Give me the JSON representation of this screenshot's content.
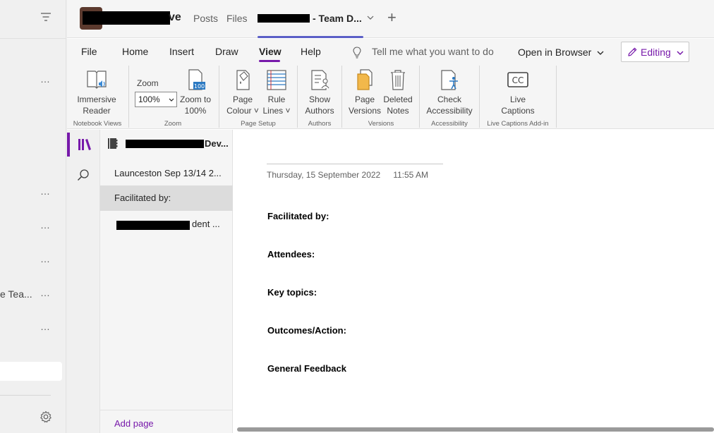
{
  "teams_sidebar": {
    "team_label_fragment": "e Tea...",
    "more_glyph": "…"
  },
  "header": {
    "team_name_suffix": "ve",
    "tabs": [
      "Posts",
      "Files"
    ],
    "active_tab_suffix": "- Team D...",
    "add_tab_glyph": "+"
  },
  "ribbon": {
    "tabs": [
      "File",
      "Home",
      "Insert",
      "Draw",
      "View",
      "Help"
    ],
    "active_tab": "View",
    "tell_me_placeholder": "Tell me what you want to do",
    "open_in_browser": "Open in Browser",
    "editing_label": "Editing",
    "buttons": {
      "immersive_reader": [
        "Immersive",
        "Reader"
      ],
      "zoom_label": "Zoom",
      "zoom_value": "100%",
      "zoom_to_100": [
        "Zoom to",
        "100%"
      ],
      "page_colour": [
        "Page",
        "Colour"
      ],
      "rule_lines": [
        "Rule",
        "Lines"
      ],
      "show_authors": [
        "Show",
        "Authors"
      ],
      "page_versions": [
        "Page",
        "Versions"
      ],
      "deleted_notes": [
        "Deleted",
        "Notes"
      ],
      "check_accessibility": [
        "Check",
        "Accessibility"
      ],
      "live_captions": [
        "Live",
        "Captions"
      ]
    },
    "groups": [
      "Notebook Views",
      "Zoom",
      "Page Setup",
      "Authors",
      "Versions",
      "Accessibility",
      "Live Captions Add-in"
    ]
  },
  "notebook": {
    "title_visible": "Dev...",
    "pages": [
      {
        "label": "Launceston Sep 13/14 2...",
        "selected": false
      },
      {
        "label": "Facilitated by:",
        "selected": true
      },
      {
        "label": "dent ...",
        "selected": false
      }
    ],
    "add_page": "Add page"
  },
  "note": {
    "date": "Thursday, 15 September 2022",
    "time": "11:55 AM",
    "headings": [
      "Facilitated by:",
      "Attendees:",
      "Key topics:",
      "Outcomes/Action:",
      "General Feedback"
    ]
  },
  "colors": {
    "accent_purple": "#7719aa",
    "teams_indigo": "#5b5fc7"
  }
}
